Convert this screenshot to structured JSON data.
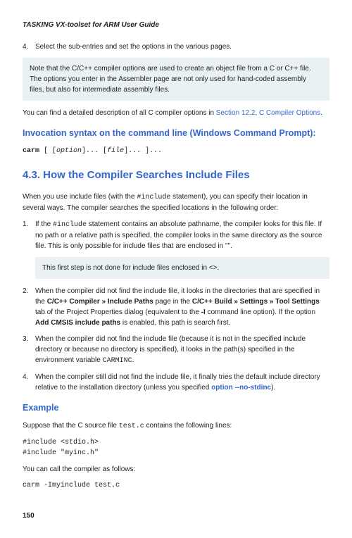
{
  "header": {
    "title": "TASKING VX-toolset for ARM User Guide"
  },
  "step4": {
    "num": "4.",
    "text": "Select the sub-entries and set the options in the various pages."
  },
  "note1": {
    "text": "Note that the C/C++ compiler options are used to create an object file from a C or C++ file. The options you enter in the Assembler page are not only used for hand-coded assembly files, but also for intermediate assembly files."
  },
  "para_detail": {
    "pre": "You can find a detailed description of all C compiler options in ",
    "link": "Section 12.2, C Compiler Options",
    "post": "."
  },
  "h_invocation": "Invocation syntax on the command line (Windows Command Prompt):",
  "code_invocation": {
    "cmd": "carm",
    "body": " [ [",
    "opt": "option",
    "mid1": "]... [",
    "file": "file",
    "mid2": "]... ]..."
  },
  "h_section": "4.3. How the Compiler Searches Include Files",
  "para_intro": {
    "pre": "When you use include files (with the ",
    "code": "#include",
    "post": " statement), you can specify their location in several ways. The compiler searches the specified locations in the following order:"
  },
  "list": {
    "item1": {
      "num": "1.",
      "pre": "If the ",
      "code": "#include",
      "post": " statement contains an absolute pathname, the compiler looks for this file. If no path or a relative path is specified, the compiler looks in the same directory as the source file. This is only possible for include files that are enclosed in \"\"."
    },
    "item1_note": "This first step is not done for include files enclosed in <>.",
    "item2": {
      "num": "2.",
      "pre": "When the compiler did not find the include file, it looks in the directories that are specified in the ",
      "b1": "C/C++ Compiler » Include Paths",
      "mid1": " page in the ",
      "b2": "C/C++ Build » Settings » Tool Settings",
      "mid2": " tab of the Project Properties dialog (equivalent to the ",
      "b3": "-I",
      "mid3": " command line option). If the option ",
      "b4": "Add CMSIS include paths",
      "post": " is enabled, this path is search first."
    },
    "item3": {
      "num": "3.",
      "pre": "When the compiler did not find the include file (because it is not in the specified include directory or because no directory is specified), it looks in the path(s) specified in the environment variable ",
      "code": "CARMINC",
      "post": "."
    },
    "item4": {
      "num": "4.",
      "pre": "When the compiler still did not find the include file, it finally tries the default include directory relative to the installation directory (unless you specified ",
      "link": "option --no-stdinc",
      "post": ")."
    }
  },
  "h_example": "Example",
  "para_example": {
    "pre": "Suppose that the C source file ",
    "code": "test.c",
    "post": " contains the following lines:"
  },
  "codeblock1": "#include <stdio.h>\n#include \"myinc.h\"",
  "para_call": "You can call the compiler as follows:",
  "codeblock2": "carm -Imyinclude test.c",
  "page_num": "150"
}
